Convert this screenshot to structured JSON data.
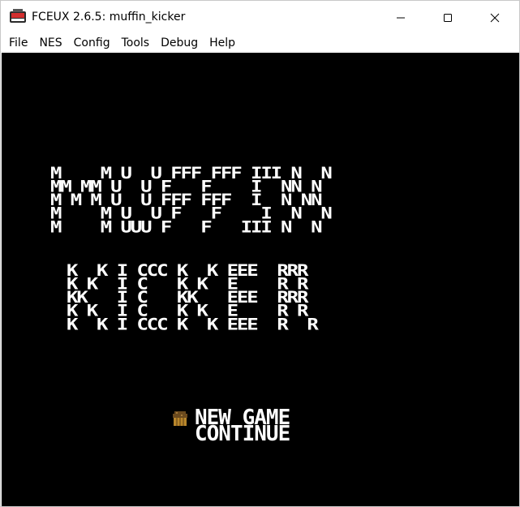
{
  "window": {
    "title": "FCEUX 2.6.5: muffin_kicker",
    "icon": "fceux-app-icon",
    "controls": [
      "minimize-icon",
      "maximize-icon",
      "close-icon"
    ]
  },
  "menubar": {
    "items": [
      {
        "label": "File"
      },
      {
        "label": "NES"
      },
      {
        "label": "Config"
      },
      {
        "label": "Tools"
      },
      {
        "label": "Debug"
      },
      {
        "label": "Help"
      }
    ]
  },
  "game": {
    "title_line1": "M    M U  U FFF FFF III N  N\nMM MM U  U F   F    I  NN N\nM M M U  U FFF FFF  I  N NN\nM    M U  U F   F    I  N  N\nM    M UUU F   F   III N  N",
    "title_line2": "K  K I CCC K  K EEE  RRR\nK K  I C   K K  E    R R\nKK   I C   KK   EEE  RRR\nK K  I C   K K  E    R R\nK  K I CCC K  K EEE  R  R",
    "menu": {
      "new_game": "NEW GAME",
      "continue": "CONTINUE",
      "selected": "NEW GAME",
      "cursor_icon": "muffin-cursor-icon"
    }
  },
  "colors": {
    "screen_bg": "#000000",
    "text": "#ffffff",
    "muffin_top": "#6b4a1e",
    "muffin_cup": "#b8862b"
  }
}
